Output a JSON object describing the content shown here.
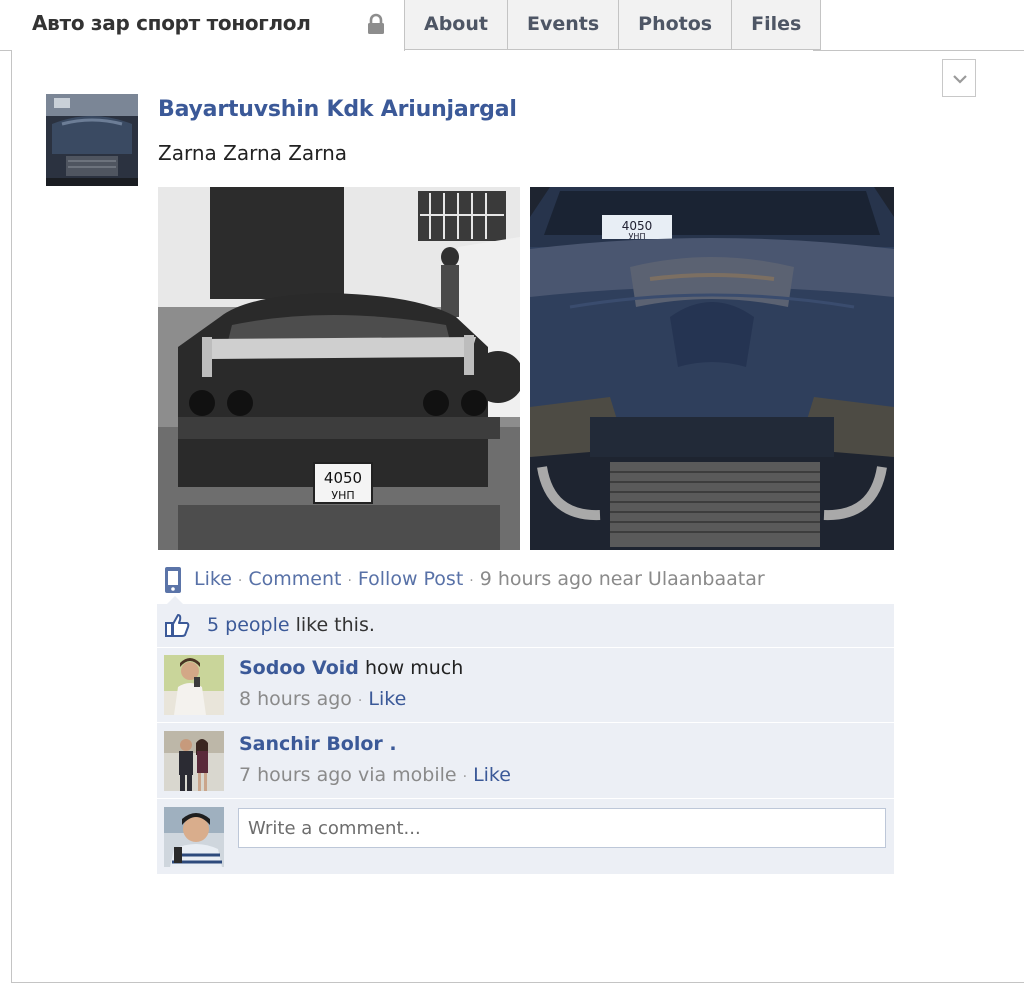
{
  "group": {
    "title": "Авто зар спорт тоноглол",
    "privacy_icon": "lock-icon"
  },
  "tabs": [
    {
      "label": "About"
    },
    {
      "label": "Events"
    },
    {
      "label": "Photos"
    },
    {
      "label": "Files"
    }
  ],
  "story_menu_icon": "chevron-down-icon",
  "post": {
    "author": "Bayartuvshin Kdk Ariunjargal",
    "text": "Zarna Zarna Zarna",
    "photos": [
      {
        "plate": "4050",
        "region": "УНП"
      },
      {
        "plate": "4050",
        "region": "УНП"
      }
    ],
    "actions": {
      "source_icon": "mobile-phone-icon",
      "like": "Like",
      "comment": "Comment",
      "follow": "Follow Post",
      "meta": "9 hours ago near Ulaanbaatar"
    },
    "likes": {
      "icon": "thumbs-up-icon",
      "count_text": "5 people",
      "suffix": " like this."
    },
    "comments": [
      {
        "author": "Sodoo Void",
        "text": "how much",
        "time": "8 hours ago",
        "like": "Like"
      },
      {
        "author": "Sanchir Bolor .",
        "text": "",
        "time": "7 hours ago via mobile",
        "like": "Like"
      }
    ],
    "composer": {
      "placeholder": "Write a comment..."
    }
  },
  "colors": {
    "link": "#3b5998",
    "feedback_bg": "#eceff5",
    "tab_bg": "#f2f2f2"
  }
}
